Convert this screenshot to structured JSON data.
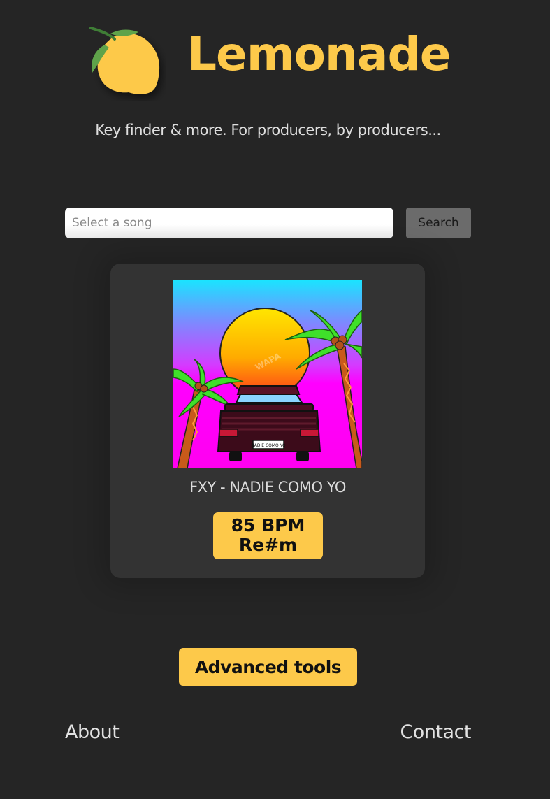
{
  "header": {
    "title": "Lemonade",
    "tagline": "Key finder & more. For producers, by producers..."
  },
  "search": {
    "placeholder": "Select a song",
    "value": "",
    "button_label": "Search"
  },
  "result": {
    "song_title": "FXY - NADIE COMO YO",
    "bpm": "85 BPM",
    "key": "Re#m",
    "cover_plate_text": "NADIE COMO YO",
    "cover_watermark": "WAPA"
  },
  "advanced_button_label": "Advanced tools",
  "footer": {
    "about": "About",
    "contact": "Contact"
  },
  "colors": {
    "background": "#252525",
    "accent": "#fdc94a",
    "card": "#333333"
  },
  "icons": {
    "logo": "lemon-icon"
  }
}
